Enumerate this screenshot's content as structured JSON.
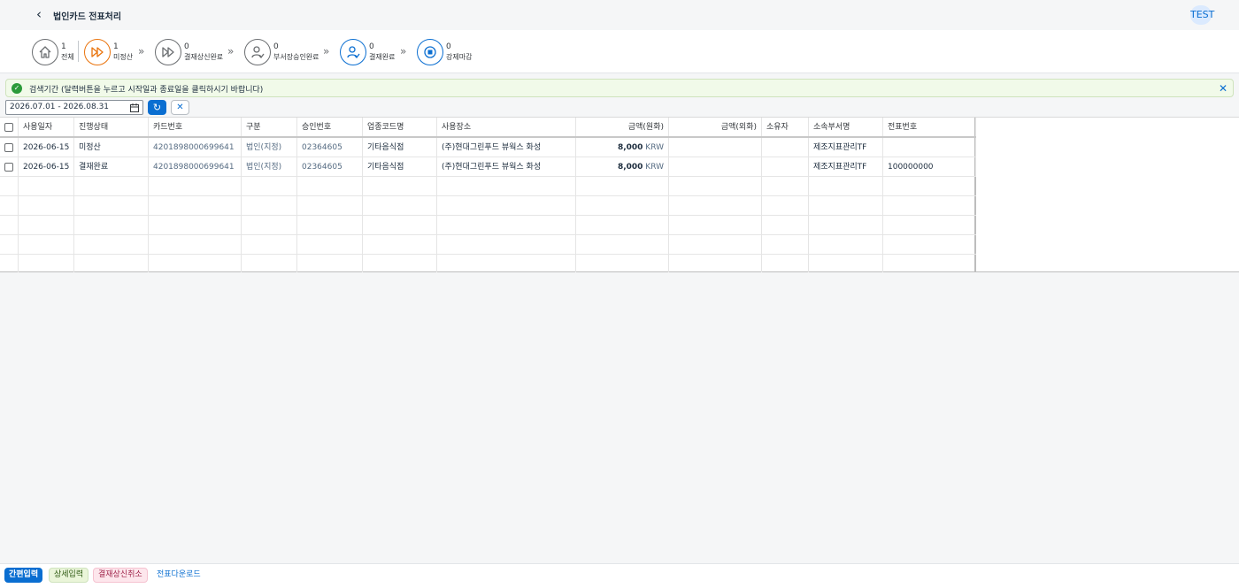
{
  "header": {
    "back_icon": "chevron-left-icon",
    "title": "법인카드 전표처리",
    "user": "TEST"
  },
  "steps": [
    {
      "count": "1",
      "label": "전체",
      "icon": "home-icon",
      "color": "#6a6d70"
    },
    {
      "count": "1",
      "label": "미정산",
      "icon": "fast-forward-icon",
      "color": "#e9730c"
    },
    {
      "count": "0",
      "label": "결재상신완료",
      "icon": "fast-forward-icon",
      "color": "#6a6d70"
    },
    {
      "count": "0",
      "label": "부서장승인완료",
      "icon": "person-check-icon",
      "color": "#6a6d70"
    },
    {
      "count": "0",
      "label": "결재완료",
      "icon": "person-check-icon",
      "color": "#0a6ed1"
    },
    {
      "count": "0",
      "label": "강제마감",
      "icon": "stop-icon",
      "color": "#0a6ed1"
    }
  ],
  "info": {
    "text": "검색기간 (달력버튼을 누르고 시작일과 종료일을 클릭하시기 바랍니다)"
  },
  "filter": {
    "date_range": "2026.07.01 - 2026.08.31"
  },
  "table": {
    "columns": [
      "사용일자",
      "진행상태",
      "카드번호",
      "구분",
      "승인번호",
      "업종코드명",
      "사용장소",
      "금액(원화)",
      "금액(외화)",
      "소유자",
      "소속부서명",
      "전표번호"
    ],
    "rows": [
      {
        "date": "2026-06-15",
        "status": "미정산",
        "card": "4201898000699641",
        "type": "법인(지정)",
        "approval": "02364605",
        "industry": "기타음식점",
        "place": "(주)현대그린푸드 뷰웍스 화성",
        "amount": "8,000",
        "currency": "KRW",
        "foreign": "",
        "owner": "",
        "dept": "제조지표관리TF",
        "voucher": ""
      },
      {
        "date": "2026-06-15",
        "status": "결재완료",
        "card": "4201898000699641",
        "type": "법인(지정)",
        "approval": "02364605",
        "industry": "기타음식점",
        "place": "(주)현대그린푸드 뷰웍스 화성",
        "amount": "8,000",
        "currency": "KRW",
        "foreign": "",
        "owner": "",
        "dept": "제조지표관리TF",
        "voucher": "100000000"
      }
    ]
  },
  "footer": {
    "quick_input": "간편입력",
    "detail_input": "상세입력",
    "cancel_submit": "결재상신취소",
    "download": "전표다운로드"
  }
}
